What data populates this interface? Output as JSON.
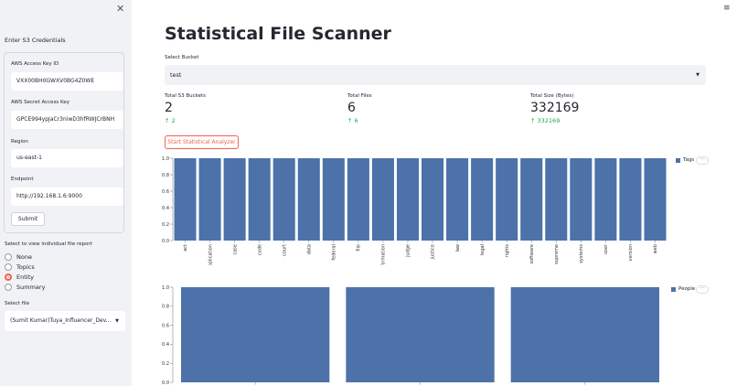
{
  "sidebar": {
    "close_icon": "✕",
    "title": "Enter S3 Credentials",
    "fields": {
      "access_key_label": "AWS Access Key ID",
      "access_key_value": "VXX00BH0GWXV0BG4Z0WE",
      "secret_key_label": "AWS Secret Access Key",
      "secret_key_value": "GPCE994ypJaCr3niwD3hfRWJCrBNH",
      "region_label": "Region",
      "region_value": "us-east-1",
      "endpoint_label": "Endpoint",
      "endpoint_value": "http://192.168.1.6:9000"
    },
    "submit_label": "Submit",
    "report_label": "Select to view individual file report",
    "report_options": [
      "None",
      "Topics",
      "Entity",
      "Summary"
    ],
    "report_selected": "Entity",
    "file_label": "Select file",
    "file_value": "(Sumit Kumar)Tuya_Influencer_Dev..."
  },
  "main": {
    "menu_icon": "≡",
    "title": "Statistical File Scanner",
    "bucket_label": "Select Bucket",
    "bucket_value": "test",
    "metrics": [
      {
        "label": "Total S3 Buckets",
        "value": "2",
        "delta": "↑ 2"
      },
      {
        "label": "Total Files",
        "value": "6",
        "delta": "↑ 6"
      },
      {
        "label": "Total Size (Bytes)",
        "value": "332169",
        "delta": "↑ 332169"
      }
    ],
    "start_button": "Start Statistical Analyzer",
    "more_icon": "···"
  },
  "colors": {
    "accent": "#f1614e",
    "bar": "#4c72a9",
    "delta": "#21a94b"
  },
  "chart_data": [
    {
      "type": "bar",
      "legend": "Tags",
      "legend_position": "top-right",
      "categories": [
        "act",
        "application",
        "case",
        "code",
        "court",
        "data",
        "federal",
        "file",
        "information",
        "judge",
        "justice",
        "law",
        "legal",
        "rights",
        "software",
        "supreme",
        "systems",
        "user",
        "version",
        "web"
      ],
      "values": [
        1,
        1,
        1,
        1,
        1,
        1,
        1,
        1,
        1,
        1,
        1,
        1,
        1,
        1,
        1,
        1,
        1,
        1,
        1,
        1
      ],
      "ylim": [
        0,
        1
      ],
      "yticks": [
        "0.0",
        "0.2",
        "0.4",
        "0.6",
        "0.8",
        "1.0"
      ],
      "grid": false
    },
    {
      "type": "bar",
      "legend": "People",
      "legend_position": "top-right",
      "categories": [
        "",
        "",
        ""
      ],
      "values": [
        1,
        1,
        1
      ],
      "ylim": [
        0,
        1
      ],
      "yticks": [
        "0.0",
        "0.2",
        "0.4",
        "0.6",
        "0.8",
        "1.0"
      ],
      "grid": false
    }
  ]
}
